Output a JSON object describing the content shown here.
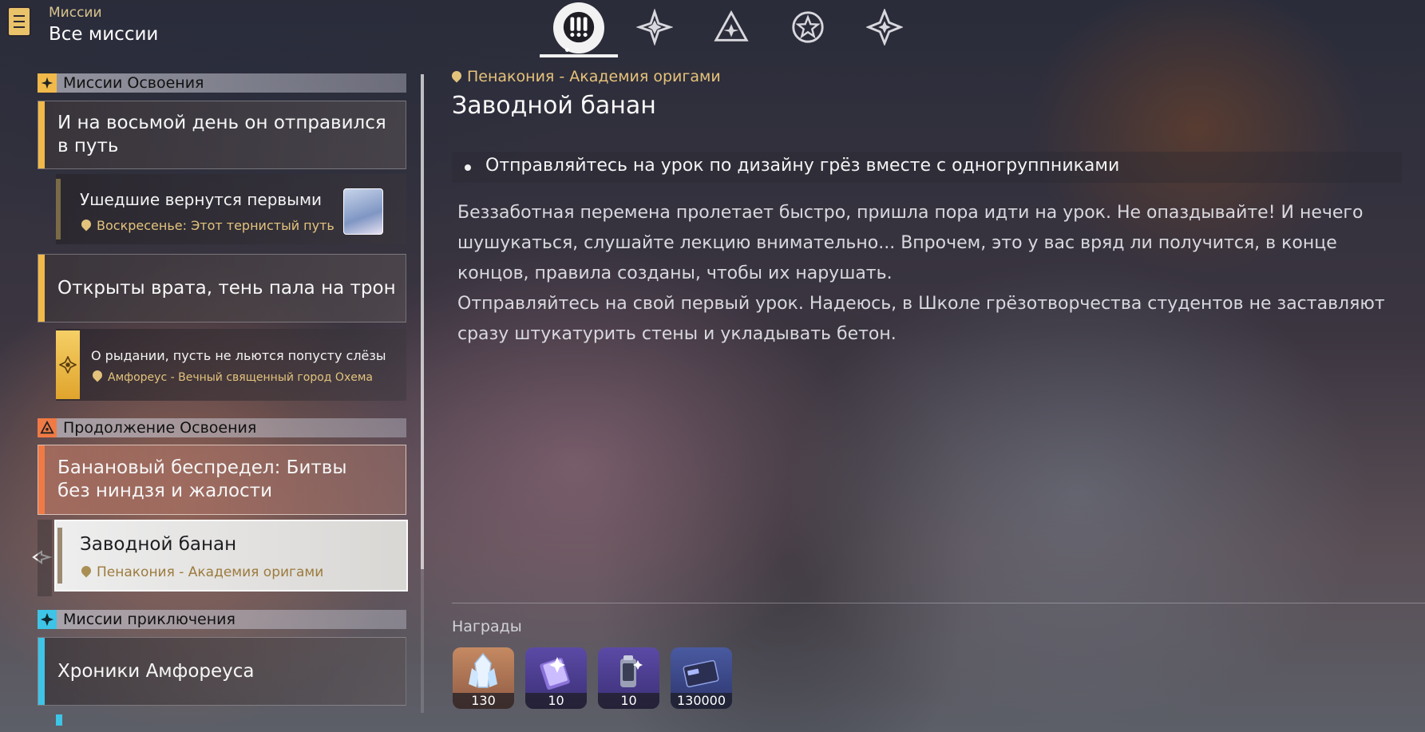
{
  "header": {
    "section": "Миссии",
    "title": "Все миссии"
  },
  "tabs": [
    {
      "name": "tab-all",
      "icon": "exclamation-icon",
      "active": true
    },
    {
      "name": "tab-trailblaze",
      "icon": "compass-star-icon",
      "active": false
    },
    {
      "name": "tab-continuance",
      "icon": "triangle-star-icon",
      "active": false
    },
    {
      "name": "tab-companion",
      "icon": "star-icon",
      "active": false
    },
    {
      "name": "tab-adventure",
      "icon": "sparkle-icon",
      "active": false
    }
  ],
  "sections": {
    "trailblaze": {
      "label": "Миссии Освоения",
      "color": "#f0b94a",
      "items": [
        {
          "title": "И на восьмой день он отправился в путь"
        },
        {
          "title": "Ушедшие вернутся первыми",
          "location": "Воскресенье: Этот тернистый путь"
        },
        {
          "title": "Открыты врата, тень пала на трон"
        },
        {
          "title": "О рыдании, пусть не льются попусту слёзы",
          "location": "Амфореус - Вечный священный город Охема"
        }
      ]
    },
    "continuance": {
      "label": "Продолжение Освоения",
      "color": "#f07a45",
      "items": [
        {
          "title": "Банановый беспредел: Битвы без ниндзя и жалости"
        },
        {
          "title": "Заводной банан",
          "location": "Пенакония - Академия оригами",
          "selected": true
        }
      ]
    },
    "adventure": {
      "label": "Миссии приключения",
      "color": "#3ec4e6",
      "items": [
        {
          "title": "Хроники Амфореуса"
        }
      ]
    }
  },
  "detail": {
    "location": "Пенакония - Академия оригами",
    "title": "Заводной банан",
    "objective": "Отправляйтесь на урок по дизайну грёз вместе с одногруппниками",
    "description": [
      "Беззаботная перемена пролетает быстро, пришла пора идти на урок. Не опаздывайте! И нечего шушукаться, слушайте лекцию внимательно... Впрочем, это у вас вряд ли получится, в конце концов, правила созданы, чтобы их нарушать.",
      "Отправляйтесь на свой первый урок. Надеюсь, в Школе грёзотворчества студентов не заставляют сразу штукатурить стены и укладывать бетон."
    ],
    "rewards_label": "Награды",
    "rewards": [
      {
        "icon": "crystal-icon",
        "count": "130"
      },
      {
        "icon": "book-icon",
        "count": "10"
      },
      {
        "icon": "canister-icon",
        "count": "10"
      },
      {
        "icon": "credit-card-icon",
        "count": "130000"
      }
    ]
  }
}
